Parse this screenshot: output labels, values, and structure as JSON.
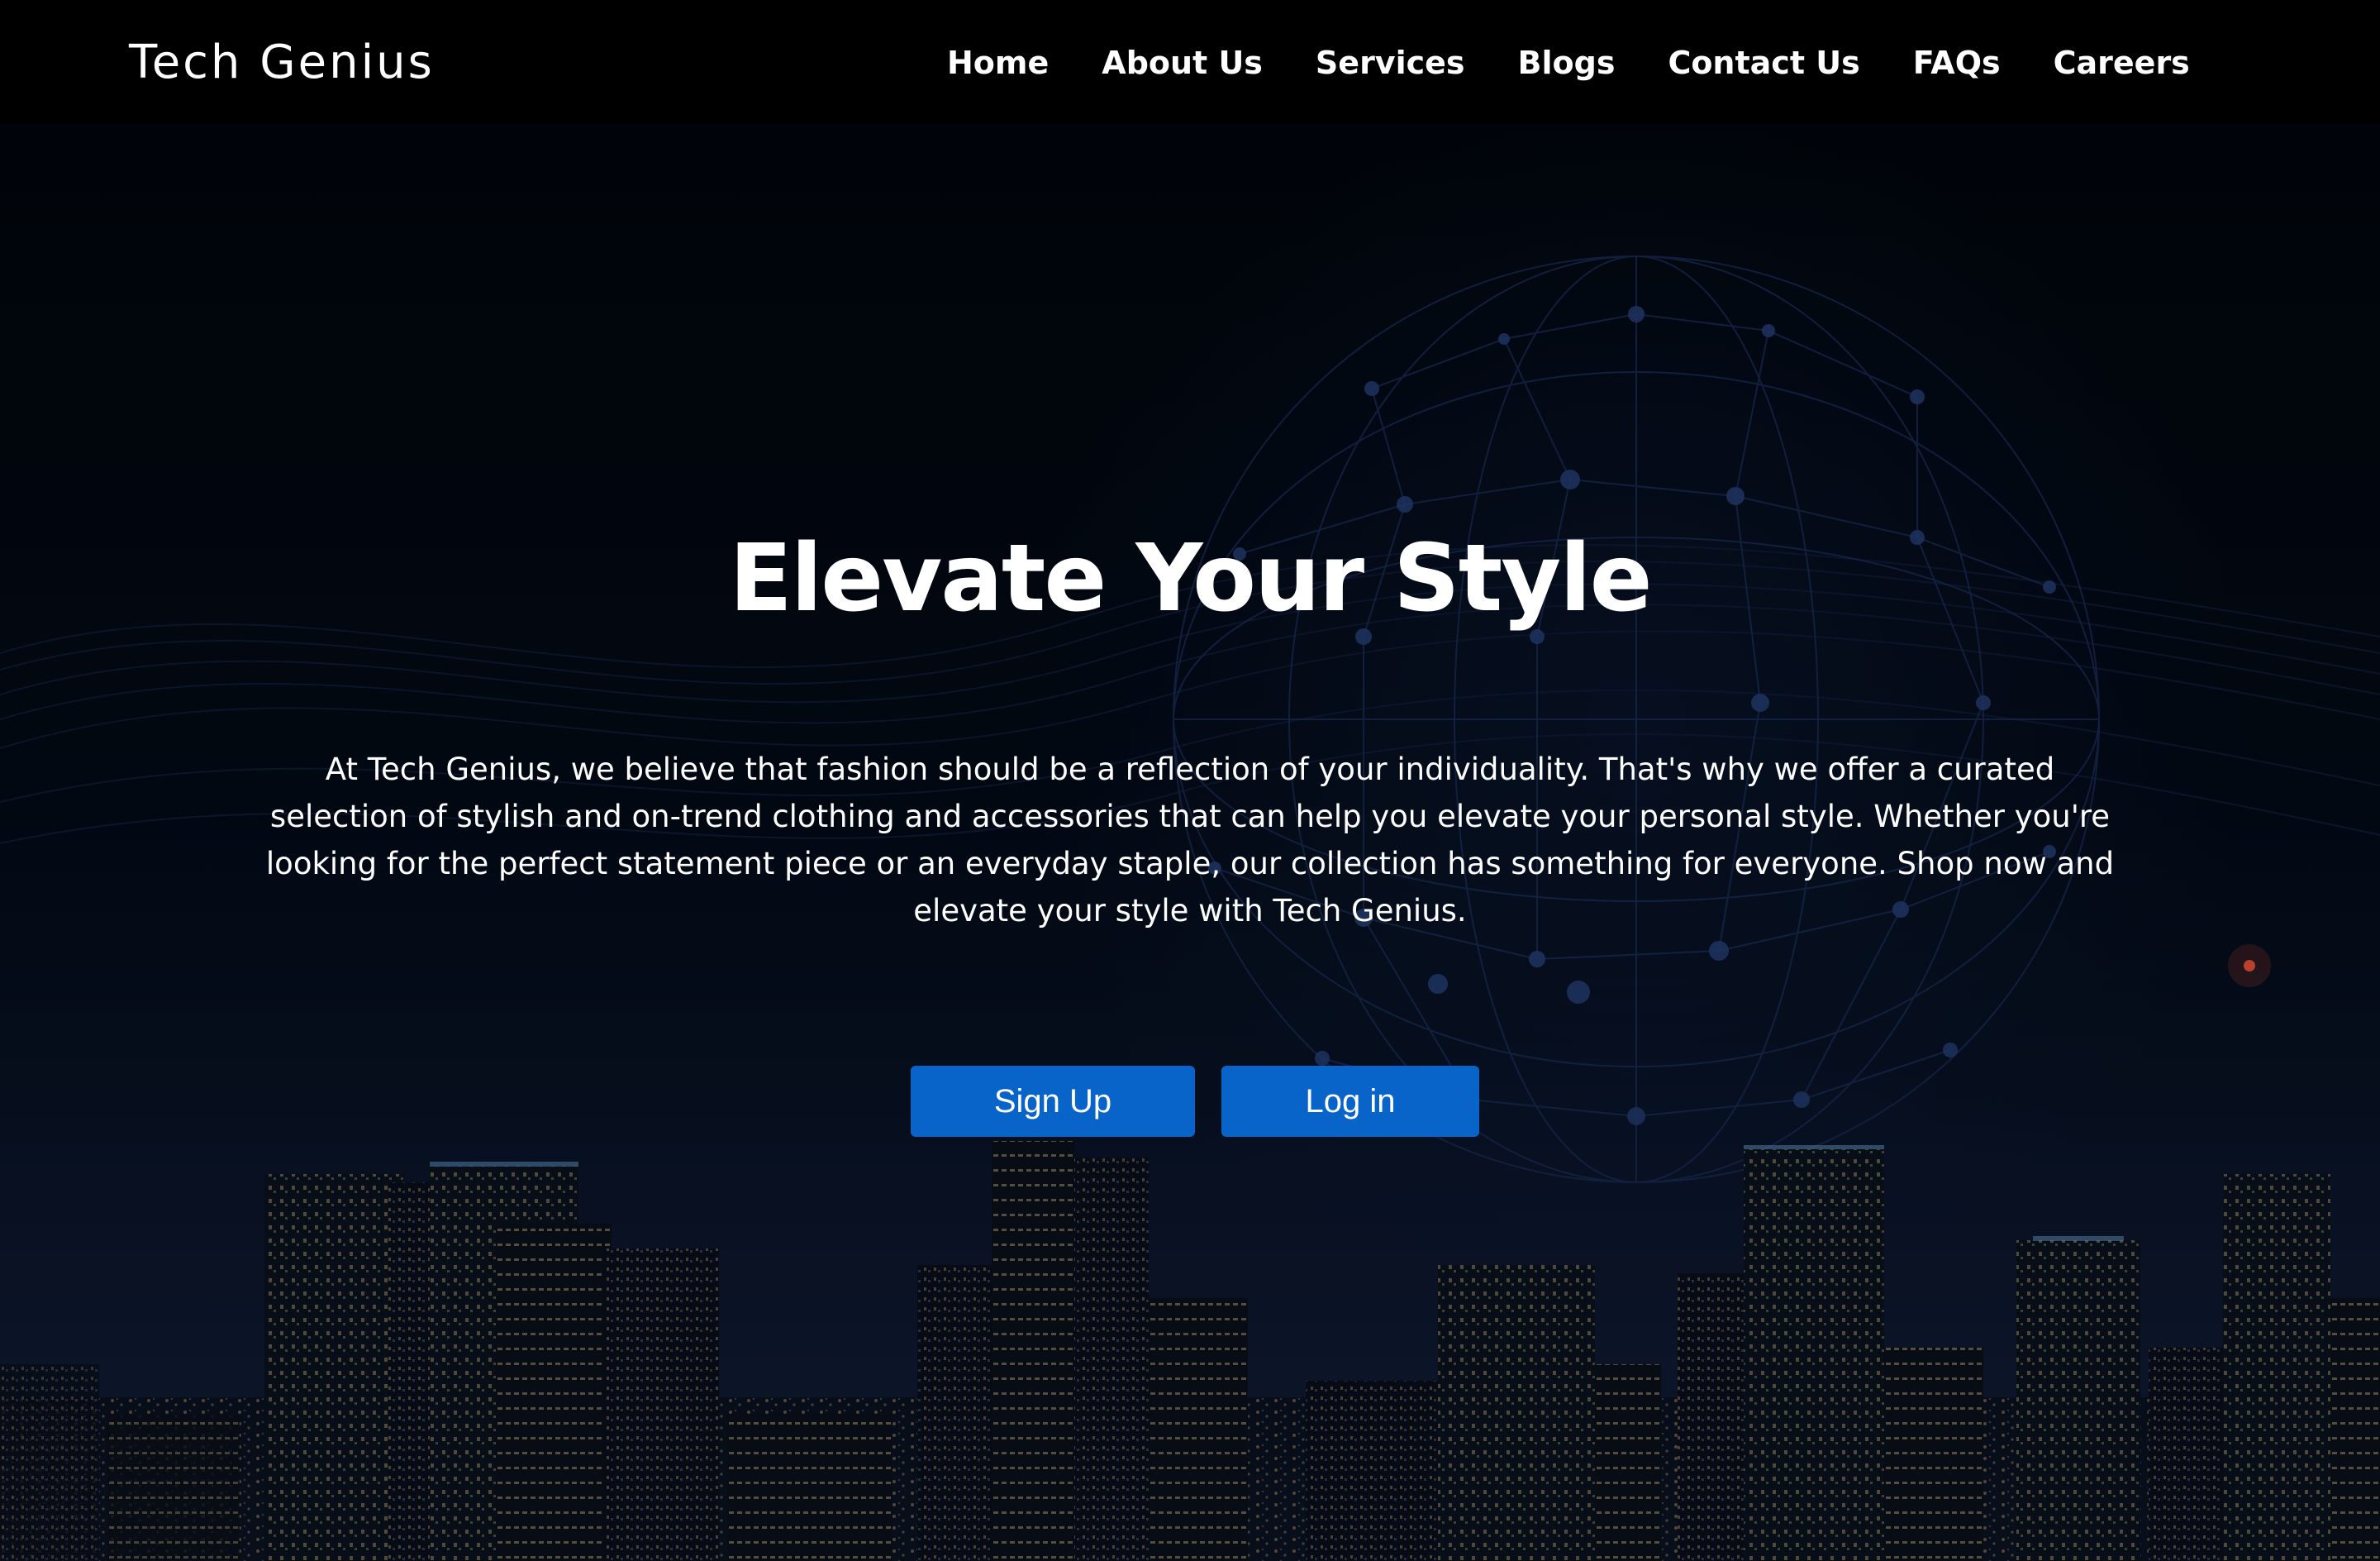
{
  "header": {
    "brand": "Tech Genius",
    "nav": [
      {
        "label": "Home"
      },
      {
        "label": "About Us"
      },
      {
        "label": "Services"
      },
      {
        "label": "Blogs"
      },
      {
        "label": "Contact Us"
      },
      {
        "label": "FAQs"
      },
      {
        "label": "Careers"
      }
    ]
  },
  "hero": {
    "title": "Elevate Your Style",
    "description": "At Tech Genius, we believe that fashion should be a reflection of your individuality. That's why we offer a curated selection of stylish and on-trend clothing and accessories that can help you elevate your personal style. Whether you're looking for the perfect statement piece or an everyday staple, our collection has something for everyone. Shop now and elevate your style with Tech Genius.",
    "buttons": {
      "signup": "Sign Up",
      "login": "Log in"
    },
    "background_image": "night-city-skyline-with-network-globe"
  },
  "colors": {
    "header_bg": "#000000",
    "page_bg": "#020409",
    "button_bg": "#0864c8",
    "text": "#ffffff"
  }
}
